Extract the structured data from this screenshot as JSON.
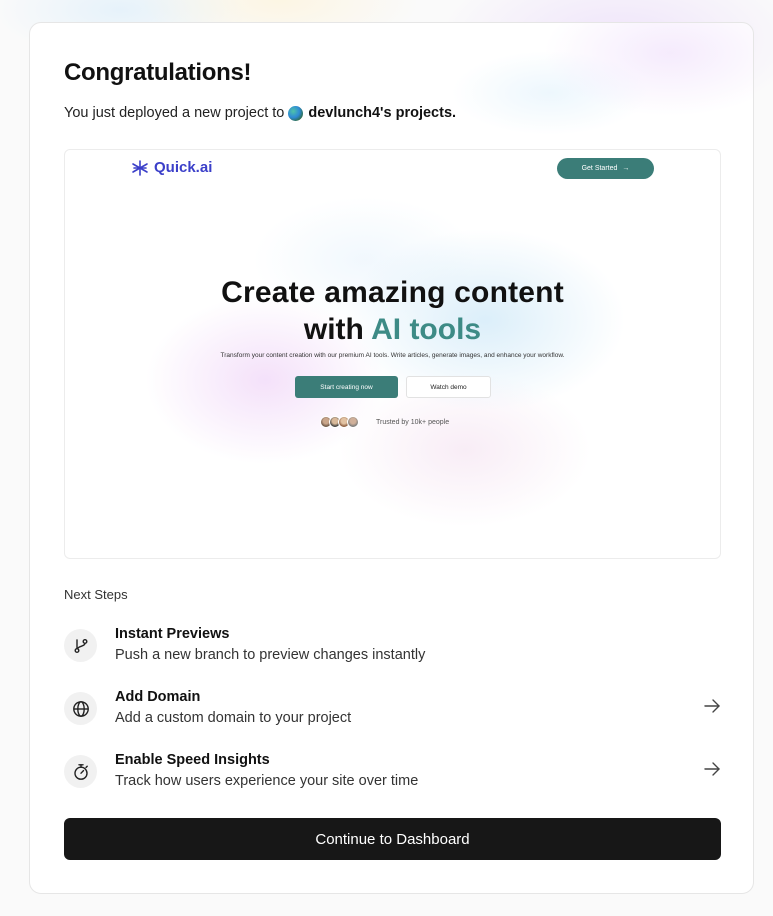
{
  "header": {
    "title": "Congratulations!",
    "subtitle_prefix": "You just deployed a new project to",
    "project_owner": "devlunch4's projects."
  },
  "preview": {
    "logo_text": "Quick.ai",
    "nav_button": "Get Started",
    "headline_line1": "Create amazing content",
    "headline_line2_plain": "with",
    "headline_line2_accent": "AI tools",
    "description": "Transform your content creation with our premium AI tools. Write articles, generate images, and enhance your workflow.",
    "primary_cta": "Start creating now",
    "secondary_cta": "Watch demo",
    "trusted_text": "Trusted by 10k+ people",
    "accent_color": "#3d8b86",
    "logo_color": "#3b3fc9"
  },
  "next_steps": {
    "label": "Next Steps",
    "items": [
      {
        "icon": "git-branch-icon",
        "title": "Instant Previews",
        "description": "Push a new branch to preview changes instantly",
        "has_arrow": false
      },
      {
        "icon": "globe-icon",
        "title": "Add Domain",
        "description": "Add a custom domain to your project",
        "has_arrow": true
      },
      {
        "icon": "stopwatch-icon",
        "title": "Enable Speed Insights",
        "description": "Track how users experience your site over time",
        "has_arrow": true
      }
    ]
  },
  "footer": {
    "continue_label": "Continue to Dashboard"
  }
}
